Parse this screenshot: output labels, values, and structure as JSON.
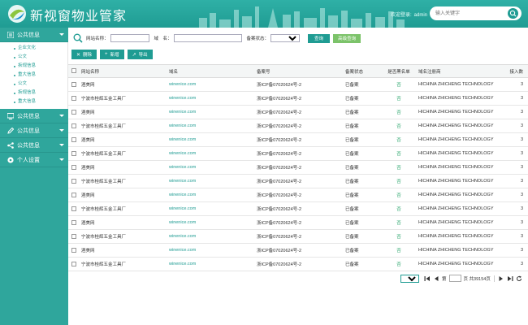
{
  "header": {
    "brand": "新视窗物业管家",
    "welcome_label": "欢迎登录:",
    "username": "admin",
    "search_placeholder": "输入关键字"
  },
  "sidebar": {
    "groups": [
      {
        "label": "公共信息",
        "icon": "list-icon",
        "expanded": true,
        "items": [
          "企业文化",
          "公文",
          "拆规信息",
          "重大信息",
          "公文",
          "拆规信息",
          "重大信息"
        ]
      },
      {
        "label": "公共信息",
        "icon": "monitor-icon"
      },
      {
        "label": "公共信息",
        "icon": "pencil-icon"
      },
      {
        "label": "公共信息",
        "icon": "share-icon"
      },
      {
        "label": "个人设置",
        "icon": "settings-icon"
      }
    ]
  },
  "search": {
    "site_name_label": "网站名称：",
    "site_name_value": "",
    "domain_label": "域　名：",
    "domain_value": "",
    "status_label": "备案状态：",
    "status_selected": "",
    "query_button": "查询",
    "advanced_button": "高级查询"
  },
  "toolbar": {
    "delete": "删除",
    "add": "新增",
    "export": "导出"
  },
  "table": {
    "columns": [
      "网站名称",
      "域名",
      "备案号",
      "备案状态",
      "是否黑名单",
      "域名注册商",
      "接入数"
    ],
    "rows": [
      [
        "酒美网",
        "winenice.com",
        "浙ICP备07020624号-2",
        "已备案",
        "否",
        "HICHINA ZHICHENG TECHNOLOGY",
        "3"
      ],
      [
        "宁波市桂辉五金工具厂",
        "winenice.com",
        "浙ICP备07020624号-2",
        "已备案",
        "否",
        "HICHINA ZHICHENG TECHNOLOGY",
        "3"
      ],
      [
        "酒美网",
        "winenice.com",
        "浙ICP备07020624号-2",
        "已备案",
        "否",
        "HICHINA ZHICHENG TECHNOLOGY",
        "3"
      ],
      [
        "宁波市桂辉五金工具厂",
        "winenice.com",
        "浙ICP备07020624号-2",
        "已备案",
        "否",
        "HICHINA ZHICHENG TECHNOLOGY",
        "3"
      ],
      [
        "酒美网",
        "winenice.com",
        "浙ICP备07020624号-2",
        "已备案",
        "否",
        "HICHINA ZHICHENG TECHNOLOGY",
        "3"
      ],
      [
        "宁波市桂辉五金工具厂",
        "winenice.com",
        "浙ICP备07020624号-2",
        "已备案",
        "否",
        "HICHINA ZHICHENG TECHNOLOGY",
        "3"
      ],
      [
        "酒美网",
        "winenice.com",
        "浙ICP备07020624号-2",
        "已备案",
        "否",
        "HICHINA ZHICHENG TECHNOLOGY",
        "3"
      ],
      [
        "宁波市桂辉五金工具厂",
        "winenice.com",
        "浙ICP备07020624号-2",
        "已备案",
        "否",
        "HICHINA ZHICHENG TECHNOLOGY",
        "3"
      ],
      [
        "酒美网",
        "winenice.com",
        "浙ICP备07020624号-2",
        "已备案",
        "否",
        "HICHINA ZHICHENG TECHNOLOGY",
        "3"
      ],
      [
        "宁波市桂辉五金工具厂",
        "winenice.com",
        "浙ICP备07020624号-2",
        "已备案",
        "否",
        "HICHINA ZHICHENG TECHNOLOGY",
        "3"
      ],
      [
        "酒美网",
        "winenice.com",
        "浙ICP备07020624号-2",
        "已备案",
        "否",
        "HICHINA ZHICHENG TECHNOLOGY",
        "3"
      ],
      [
        "宁波市桂辉五金工具厂",
        "winenice.com",
        "浙ICP备07020624号-2",
        "已备案",
        "否",
        "HICHINA ZHICHENG TECHNOLOGY",
        "3"
      ],
      [
        "酒美网",
        "winenice.com",
        "浙ICP备07020624号-2",
        "已备案",
        "否",
        "HICHINA ZHICHENG TECHNOLOGY",
        "3"
      ],
      [
        "宁波市桂辉五金工具厂",
        "winenice.com",
        "浙ICP备07020624号-2",
        "已备案",
        "否",
        "HICHINA ZHICHENG TECHNOLOGY",
        "3"
      ]
    ]
  },
  "pager": {
    "page_label": "第",
    "page_value": "",
    "total_label": "页 共39154页"
  },
  "colors": {
    "primary": "#1f9c93",
    "sidebar": "#2fa69c",
    "accent": "#7cc36a"
  }
}
